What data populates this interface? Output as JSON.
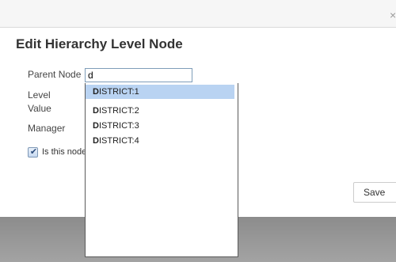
{
  "dialog": {
    "title": "Edit Hierarchy Level Node",
    "close_glyph": "×"
  },
  "form": {
    "parent_node_label": "Parent Node",
    "parent_node_value": "d",
    "level_label": "Level",
    "value_label": "Value",
    "manager_label": "Manager",
    "checkbox_label": "Is this node",
    "checkbox_checked": true
  },
  "dropdown": {
    "items": [
      {
        "match": "D",
        "rest": "ISTRICT:1",
        "selected": true
      },
      {
        "match": "D",
        "rest": "ISTRICT:2",
        "selected": false
      },
      {
        "match": "D",
        "rest": "ISTRICT:3",
        "selected": false
      },
      {
        "match": "D",
        "rest": "ISTRICT:4",
        "selected": false
      }
    ]
  },
  "actions": {
    "save_label": "Save"
  },
  "colors": {
    "selected_item_bg": "#b9d3f2",
    "bottom_overlay": "#8c8c8c"
  }
}
